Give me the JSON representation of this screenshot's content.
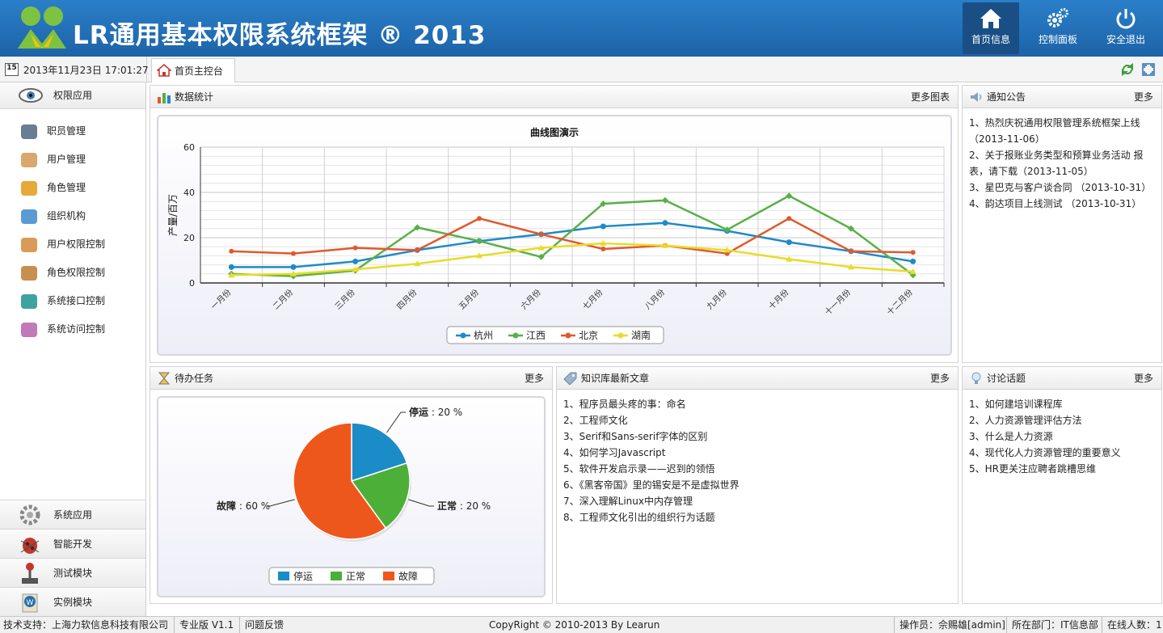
{
  "header": {
    "title": "LR通用基本权限系统框架 ® 2013",
    "buttons": [
      {
        "label": "首页信息",
        "icon": "home-icon",
        "active": true
      },
      {
        "label": "控制面板",
        "icon": "gear-icon"
      },
      {
        "label": "安全退出",
        "icon": "power-icon"
      }
    ]
  },
  "topbar": {
    "datetime": "2013年11月23日 17:01:27",
    "calendar_day": "15",
    "home_tab": "首页主控台"
  },
  "sidebar": {
    "top_group": "权限应用",
    "items": [
      "职员管理",
      "用户管理",
      "角色管理",
      "组织机构",
      "用户权限控制",
      "角色权限控制",
      "系统接口控制",
      "系统访问控制"
    ],
    "bottom_groups": [
      "系统应用",
      "智能开发",
      "测试模块",
      "实例模块"
    ]
  },
  "panels": {
    "stats": {
      "title": "数据统计",
      "more": "更多图表"
    },
    "notice": {
      "title": "通知公告",
      "more": "更多",
      "items": [
        "1、热烈庆祝通用权限管理系统框架上线",
        "（2013-11-06）",
        "2、关于报账业务类型和预算业务活动 报",
        "表，请下载（2013-11-05）",
        "3、星巴克与客户谈合同 （2013-10-31）",
        "4、韵达项目上线测试 （2013-10-31）"
      ]
    },
    "todo": {
      "title": "待办任务",
      "more": "更多"
    },
    "kb": {
      "title": "知识库最新文章",
      "more": "更多",
      "items": [
        "1、程序员最头疼的事：命名",
        "2、工程师文化",
        "3、Serif和Sans-serif字体的区别",
        "4、如何学习Javascript",
        "5、软件开发启示录——迟到的领悟",
        "6、《黑客帝国》里的锡安是不是虚拟世界",
        "7、深入理解Linux中内存管理",
        "8、工程师文化引出的组织行为话题"
      ]
    },
    "discuss": {
      "title": "讨论话题",
      "more": "更多",
      "items": [
        "1、如何建培训课程库",
        "2、人力资源管理评估方法",
        "3、什么是人力资源",
        "4、现代化人力资源管理的重要意义",
        "5、HR更关注应聘者跳槽思维"
      ]
    }
  },
  "chart_data": [
    {
      "type": "line",
      "title": "曲线图演示",
      "ylabel": "产量/百万",
      "ylim": [
        0,
        60
      ],
      "yticks": [
        0,
        20,
        40,
        60
      ],
      "grid": true,
      "legend": "bottom",
      "categories": [
        "一月份",
        "二月份",
        "三月份",
        "四月份",
        "五月份",
        "六月份",
        "七月份",
        "八月份",
        "九月份",
        "十月份",
        "十一月份",
        "十二月份"
      ],
      "series": [
        {
          "name": "杭州",
          "color": "#1f8ac8",
          "values": [
            7,
            7,
            9.5,
            14.5,
            18.5,
            21.5,
            25,
            26.5,
            23,
            18,
            14,
            9.5
          ]
        },
        {
          "name": "江西",
          "color": "#58b048",
          "values": [
            4,
            3,
            5.5,
            24.5,
            18.5,
            11.5,
            35,
            36.5,
            23.5,
            38.5,
            24,
            3.5
          ]
        },
        {
          "name": "北京",
          "color": "#e0592e",
          "values": [
            14,
            13,
            15.5,
            14.5,
            28.5,
            21.5,
            15,
            16.5,
            13,
            28.5,
            14,
            13.5
          ]
        },
        {
          "name": "湖南",
          "color": "#e8dc2a",
          "values": [
            3.5,
            4,
            6,
            8.5,
            12,
            15.5,
            17.5,
            16.5,
            14.5,
            10.5,
            7,
            5
          ]
        }
      ]
    },
    {
      "type": "pie",
      "slices": [
        {
          "name": "停运",
          "value": 20,
          "color": "#1b8cc8",
          "label": "20 %"
        },
        {
          "name": "正常",
          "value": 20,
          "color": "#4caf37",
          "label": "20 %"
        },
        {
          "name": "故障",
          "value": 60,
          "color": "#ee571c",
          "label": "60 %"
        }
      ],
      "legend": "bottom"
    }
  ],
  "footer": {
    "support": "技术支持：上海力软信息科技有限公司",
    "version": "专业版 V1.1",
    "feedback": "问题反馈",
    "copyright": "CopyRight © 2010-2013 By Learun",
    "operator": "操作员：佘赐雄[admin]",
    "dept": "所在部门：IT信息部",
    "online": "在线人数：1"
  }
}
